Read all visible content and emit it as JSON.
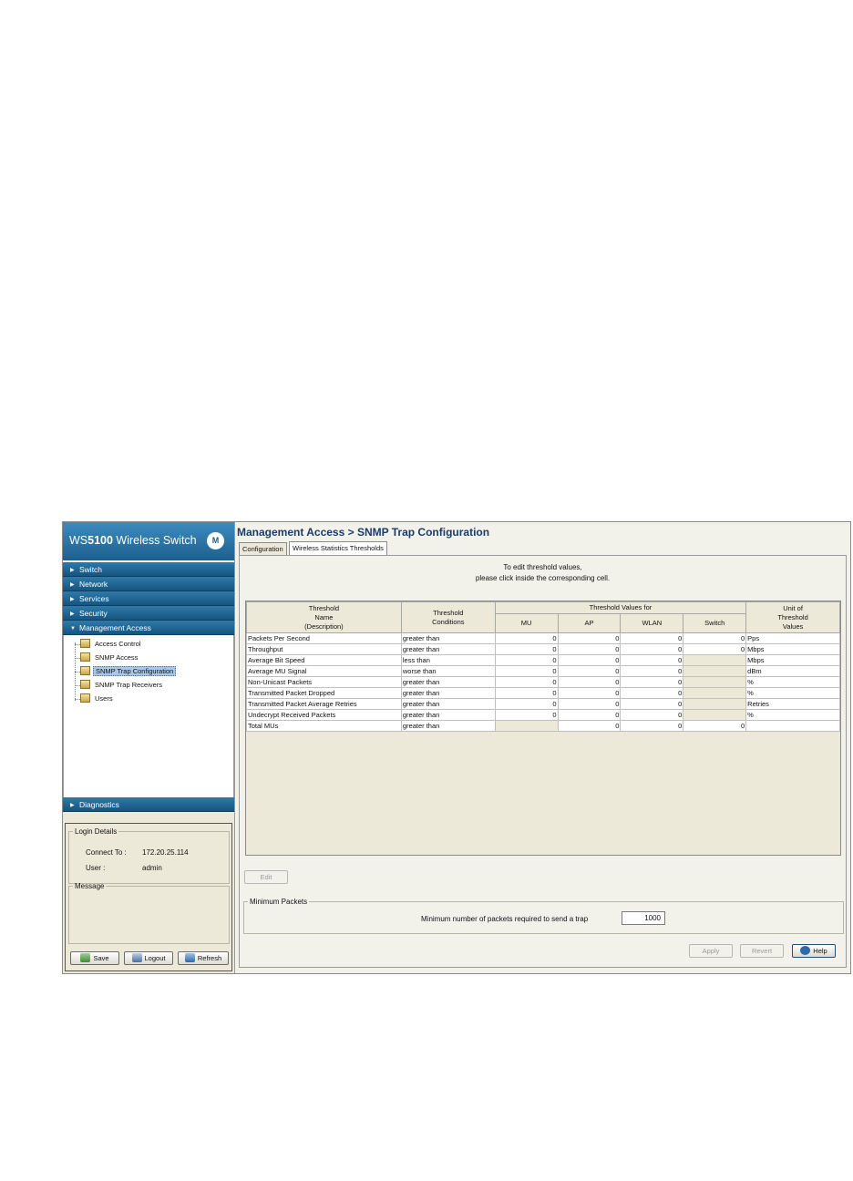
{
  "sidebar": {
    "brand_prefix": "WS",
    "brand_model": "5100",
    "brand_suffix": " Wireless Switch",
    "logo_glyph": "M",
    "nav": [
      {
        "label": "Switch",
        "expanded": false
      },
      {
        "label": "Network",
        "expanded": false
      },
      {
        "label": "Services",
        "expanded": false
      },
      {
        "label": "Security",
        "expanded": false
      },
      {
        "label": "Management Access",
        "expanded": true
      }
    ],
    "tree": [
      {
        "label": "Access Control",
        "selected": false
      },
      {
        "label": "SNMP Access",
        "selected": false
      },
      {
        "label": "SNMP Trap Configuration",
        "selected": true
      },
      {
        "label": "SNMP Trap Receivers",
        "selected": false
      },
      {
        "label": "Users",
        "selected": false
      }
    ],
    "diagnostics_label": "Diagnostics",
    "login": {
      "legend": "Login Details",
      "connect_label": "Connect To :",
      "connect_value": "172.20.25.114",
      "user_label": "User :",
      "user_value": "admin"
    },
    "message_legend": "Message",
    "buttons": {
      "save": "Save",
      "logout": "Logout",
      "refresh": "Refresh"
    }
  },
  "main": {
    "title": "Management Access > SNMP Trap Configuration",
    "tabs": [
      {
        "label": "Configuration",
        "active": false
      },
      {
        "label": "Wireless Statistics Thresholds",
        "active": true
      }
    ],
    "instructions_line1": "To edit threshold values,",
    "instructions_line2": "please click inside the corresponding cell.",
    "table": {
      "h_name": [
        "Threshold",
        "Name",
        "(Description)"
      ],
      "h_cond": [
        "Threshold",
        "Conditions"
      ],
      "h_values_for": "Threshold Values for",
      "h_mu": "MU",
      "h_ap": "AP",
      "h_wlan": "WLAN",
      "h_switch": "Switch",
      "h_unit": [
        "Unit of",
        "Threshold",
        "Values"
      ],
      "rows": [
        {
          "name": "Packets Per Second",
          "cond": "greater than",
          "mu": "0",
          "ap": "0",
          "wlan": "0",
          "sw": "0",
          "unit": "Pps"
        },
        {
          "name": "Throughput",
          "cond": "greater than",
          "mu": "0",
          "ap": "0",
          "wlan": "0",
          "sw": "0",
          "unit": "Mbps"
        },
        {
          "name": "Average Bit Speed",
          "cond": "less than",
          "mu": "0",
          "ap": "0",
          "wlan": "0",
          "sw": null,
          "unit": "Mbps"
        },
        {
          "name": "Average MU Signal",
          "cond": "worse than",
          "mu": "0",
          "ap": "0",
          "wlan": "0",
          "sw": null,
          "unit": "dBm"
        },
        {
          "name": "Non-Unicast Packets",
          "cond": "greater than",
          "mu": "0",
          "ap": "0",
          "wlan": "0",
          "sw": null,
          "unit": "%"
        },
        {
          "name": "Transmitted Packet Dropped",
          "cond": "greater than",
          "mu": "0",
          "ap": "0",
          "wlan": "0",
          "sw": null,
          "unit": "%"
        },
        {
          "name": "Transmitted Packet Average Retries",
          "cond": "greater than",
          "mu": "0",
          "ap": "0",
          "wlan": "0",
          "sw": null,
          "unit": "Retries"
        },
        {
          "name": "Undecrypt Received Packets",
          "cond": "greater than",
          "mu": "0",
          "ap": "0",
          "wlan": "0",
          "sw": null,
          "unit": "%"
        },
        {
          "name": "Total MUs",
          "cond": "greater than",
          "mu": null,
          "ap": "0",
          "wlan": "0",
          "sw": "0",
          "unit": ""
        }
      ]
    },
    "edit_label": "Edit",
    "min_packets": {
      "legend": "Minimum Packets",
      "label": "Minimum number of packets required to send a trap",
      "value": "1000"
    },
    "buttons": {
      "apply": "Apply",
      "revert": "Revert",
      "help": "Help"
    }
  }
}
